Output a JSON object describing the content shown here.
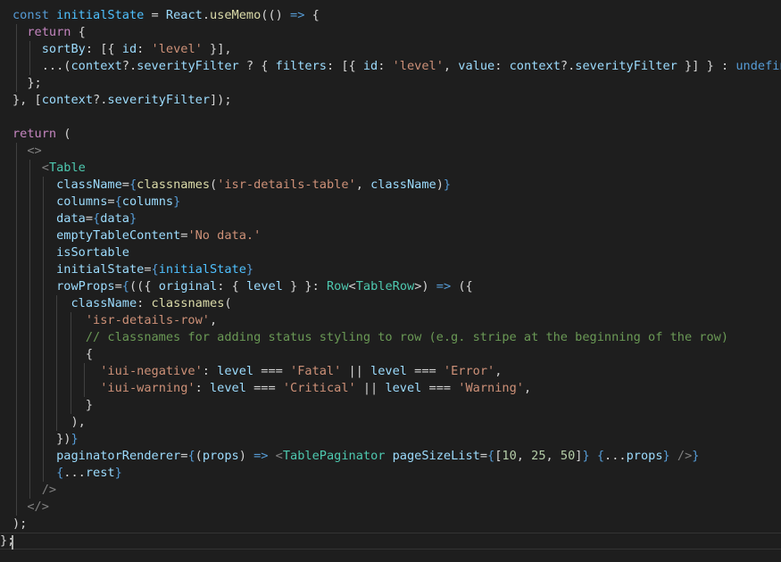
{
  "colors": {
    "background": "#1e1e1e",
    "keyword": "#569cd6",
    "control": "#c586c0",
    "variable": "#9cdcfe",
    "constant": "#4fc1ff",
    "function": "#dcdcaa",
    "string": "#ce9178",
    "number": "#b5cea8",
    "type": "#4ec9b0",
    "comment": "#6a9955",
    "punctuation": "#d4d4d4",
    "tag_bracket": "#808080"
  },
  "code_lines": [
    [
      [
        "const",
        "keyword"
      ],
      [
        " ",
        "punctuation"
      ],
      [
        "initialState",
        "constant"
      ],
      [
        " = ",
        "punctuation"
      ],
      [
        "React",
        "variable"
      ],
      [
        ".",
        "punctuation"
      ],
      [
        "useMemo",
        "function"
      ],
      [
        "(() ",
        "punctuation"
      ],
      [
        "=>",
        "keyword"
      ],
      [
        " {",
        "punctuation"
      ]
    ],
    [
      [
        "  ",
        "punctuation"
      ],
      [
        "return",
        "control"
      ],
      [
        " {",
        "punctuation"
      ]
    ],
    [
      [
        "    ",
        "punctuation"
      ],
      [
        "sortBy",
        "variable"
      ],
      [
        ": [{ ",
        "punctuation"
      ],
      [
        "id",
        "variable"
      ],
      [
        ": ",
        "punctuation"
      ],
      [
        "'level'",
        "string"
      ],
      [
        " }],",
        "punctuation"
      ]
    ],
    [
      [
        "    ...(",
        "punctuation"
      ],
      [
        "context",
        "variable"
      ],
      [
        "?.",
        "punctuation"
      ],
      [
        "severityFilter",
        "variable"
      ],
      [
        " ? { ",
        "punctuation"
      ],
      [
        "filters",
        "variable"
      ],
      [
        ": [{ ",
        "punctuation"
      ],
      [
        "id",
        "variable"
      ],
      [
        ": ",
        "punctuation"
      ],
      [
        "'level'",
        "string"
      ],
      [
        ", ",
        "punctuation"
      ],
      [
        "value",
        "variable"
      ],
      [
        ": ",
        "punctuation"
      ],
      [
        "context",
        "variable"
      ],
      [
        "?.",
        "punctuation"
      ],
      [
        "severityFilter",
        "variable"
      ],
      [
        " }] } : ",
        "punctuation"
      ],
      [
        "undefined",
        "keyword"
      ],
      [
        "),",
        "punctuation"
      ]
    ],
    [
      [
        "  };",
        "punctuation"
      ]
    ],
    [
      [
        "}, [",
        "punctuation"
      ],
      [
        "context",
        "variable"
      ],
      [
        "?.",
        "punctuation"
      ],
      [
        "severityFilter",
        "variable"
      ],
      [
        "]);",
        "punctuation"
      ]
    ],
    [],
    [
      [
        "return",
        "control"
      ],
      [
        " (",
        "punctuation"
      ]
    ],
    [
      [
        "  ",
        "punctuation"
      ],
      [
        "<>",
        "tag_bracket"
      ]
    ],
    [
      [
        "    ",
        "punctuation"
      ],
      [
        "<",
        "tag_bracket"
      ],
      [
        "Table",
        "type"
      ]
    ],
    [
      [
        "      ",
        "punctuation"
      ],
      [
        "className",
        "variable"
      ],
      [
        "=",
        "punctuation"
      ],
      [
        "{",
        "keyword"
      ],
      [
        "classnames",
        "function"
      ],
      [
        "(",
        "punctuation"
      ],
      [
        "'isr-details-table'",
        "string"
      ],
      [
        ", ",
        "punctuation"
      ],
      [
        "className",
        "variable"
      ],
      [
        ")",
        "punctuation"
      ],
      [
        "}",
        "keyword"
      ]
    ],
    [
      [
        "      ",
        "punctuation"
      ],
      [
        "columns",
        "variable"
      ],
      [
        "=",
        "punctuation"
      ],
      [
        "{",
        "keyword"
      ],
      [
        "columns",
        "variable"
      ],
      [
        "}",
        "keyword"
      ]
    ],
    [
      [
        "      ",
        "punctuation"
      ],
      [
        "data",
        "variable"
      ],
      [
        "=",
        "punctuation"
      ],
      [
        "{",
        "keyword"
      ],
      [
        "data",
        "variable"
      ],
      [
        "}",
        "keyword"
      ]
    ],
    [
      [
        "      ",
        "punctuation"
      ],
      [
        "emptyTableContent",
        "variable"
      ],
      [
        "=",
        "punctuation"
      ],
      [
        "'No data.'",
        "string"
      ]
    ],
    [
      [
        "      ",
        "punctuation"
      ],
      [
        "isSortable",
        "variable"
      ]
    ],
    [
      [
        "      ",
        "punctuation"
      ],
      [
        "initialState",
        "variable"
      ],
      [
        "=",
        "punctuation"
      ],
      [
        "{",
        "keyword"
      ],
      [
        "initialState",
        "constant"
      ],
      [
        "}",
        "keyword"
      ]
    ],
    [
      [
        "      ",
        "punctuation"
      ],
      [
        "rowProps",
        "variable"
      ],
      [
        "=",
        "punctuation"
      ],
      [
        "{",
        "keyword"
      ],
      [
        "(({ ",
        "punctuation"
      ],
      [
        "original",
        "variable"
      ],
      [
        ": { ",
        "punctuation"
      ],
      [
        "level",
        "variable"
      ],
      [
        " } }: ",
        "punctuation"
      ],
      [
        "Row",
        "type"
      ],
      [
        "<",
        "punctuation"
      ],
      [
        "TableRow",
        "type"
      ],
      [
        ">) ",
        "punctuation"
      ],
      [
        "=>",
        "keyword"
      ],
      [
        " ({",
        "punctuation"
      ]
    ],
    [
      [
        "        ",
        "punctuation"
      ],
      [
        "className",
        "variable"
      ],
      [
        ": ",
        "punctuation"
      ],
      [
        "classnames",
        "function"
      ],
      [
        "(",
        "punctuation"
      ]
    ],
    [
      [
        "          ",
        "punctuation"
      ],
      [
        "'isr-details-row'",
        "string"
      ],
      [
        ",",
        "punctuation"
      ]
    ],
    [
      [
        "          ",
        "punctuation"
      ],
      [
        "// classnames for adding status styling to row (e.g. stripe at the beginning of the row)",
        "comment"
      ]
    ],
    [
      [
        "          {",
        "punctuation"
      ]
    ],
    [
      [
        "            ",
        "punctuation"
      ],
      [
        "'iui-negative'",
        "string"
      ],
      [
        ": ",
        "punctuation"
      ],
      [
        "level",
        "variable"
      ],
      [
        " === ",
        "punctuation"
      ],
      [
        "'Fatal'",
        "string"
      ],
      [
        " || ",
        "punctuation"
      ],
      [
        "level",
        "variable"
      ],
      [
        " === ",
        "punctuation"
      ],
      [
        "'Error'",
        "string"
      ],
      [
        ",",
        "punctuation"
      ]
    ],
    [
      [
        "            ",
        "punctuation"
      ],
      [
        "'iui-warning'",
        "string"
      ],
      [
        ": ",
        "punctuation"
      ],
      [
        "level",
        "variable"
      ],
      [
        " === ",
        "punctuation"
      ],
      [
        "'Critical'",
        "string"
      ],
      [
        " || ",
        "punctuation"
      ],
      [
        "level",
        "variable"
      ],
      [
        " === ",
        "punctuation"
      ],
      [
        "'Warning'",
        "string"
      ],
      [
        ",",
        "punctuation"
      ]
    ],
    [
      [
        "          }",
        "punctuation"
      ]
    ],
    [
      [
        "        ),",
        "punctuation"
      ]
    ],
    [
      [
        "      ",
        "punctuation"
      ],
      [
        "})",
        "punctuation"
      ],
      [
        "}",
        "keyword"
      ]
    ],
    [
      [
        "      ",
        "punctuation"
      ],
      [
        "paginatorRenderer",
        "variable"
      ],
      [
        "=",
        "punctuation"
      ],
      [
        "{",
        "keyword"
      ],
      [
        "(",
        "punctuation"
      ],
      [
        "props",
        "variable"
      ],
      [
        ") ",
        "punctuation"
      ],
      [
        "=>",
        "keyword"
      ],
      [
        " ",
        "punctuation"
      ],
      [
        "<",
        "tag_bracket"
      ],
      [
        "TablePaginator",
        "type"
      ],
      [
        " ",
        "punctuation"
      ],
      [
        "pageSizeList",
        "variable"
      ],
      [
        "=",
        "punctuation"
      ],
      [
        "{",
        "keyword"
      ],
      [
        "[",
        "punctuation"
      ],
      [
        "10",
        "number"
      ],
      [
        ", ",
        "punctuation"
      ],
      [
        "25",
        "number"
      ],
      [
        ", ",
        "punctuation"
      ],
      [
        "50",
        "number"
      ],
      [
        "]",
        "punctuation"
      ],
      [
        "}",
        "keyword"
      ],
      [
        " ",
        "punctuation"
      ],
      [
        "{",
        "keyword"
      ],
      [
        "...",
        "punctuation"
      ],
      [
        "props",
        "variable"
      ],
      [
        "}",
        "keyword"
      ],
      [
        " ",
        "punctuation"
      ],
      [
        "/>",
        "tag_bracket"
      ],
      [
        "}",
        "keyword"
      ]
    ],
    [
      [
        "      ",
        "punctuation"
      ],
      [
        "{",
        "keyword"
      ],
      [
        "...",
        "punctuation"
      ],
      [
        "rest",
        "variable"
      ],
      [
        "}",
        "keyword"
      ]
    ],
    [
      [
        "    ",
        "punctuation"
      ],
      [
        "/>",
        "tag_bracket"
      ]
    ],
    [
      [
        "  ",
        "punctuation"
      ],
      [
        "</>",
        "tag_bracket"
      ]
    ],
    [
      [
        ");",
        "punctuation"
      ]
    ],
    [
      [
        "};",
        "punctuation"
      ]
    ]
  ]
}
